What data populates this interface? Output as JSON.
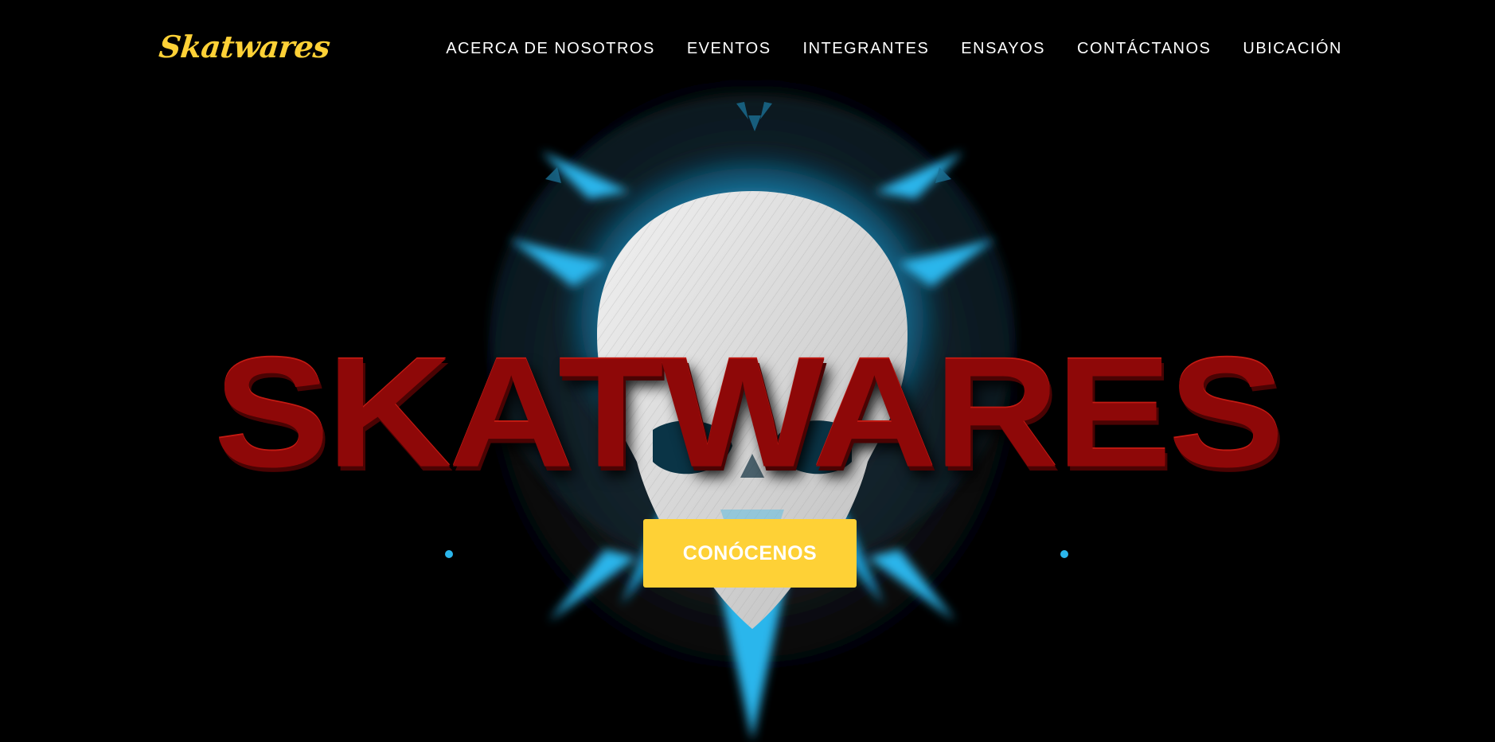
{
  "nav": {
    "brand": "Skatwares",
    "links": [
      "ACERCA DE NOSOTROS",
      "EVENTOS",
      "INTEGRANTES",
      "ENSAYOS",
      "CONTÁCTANOS",
      "UBICACIÓN"
    ]
  },
  "hero": {
    "title_art": "SKATWARES",
    "cta_label": "CONÓCENOS",
    "image_icon": "skull-icon"
  },
  "colors": {
    "background": "#000000",
    "accent": "#fed136",
    "title": "#8e0808",
    "glow": "#2fc3f5"
  }
}
